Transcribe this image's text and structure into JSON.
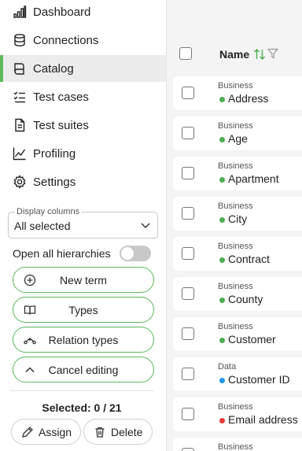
{
  "nav": {
    "items": [
      {
        "label": "Dashboard",
        "icon": "bar-chart-icon",
        "active": false
      },
      {
        "label": "Connections",
        "icon": "database-icon",
        "active": false
      },
      {
        "label": "Catalog",
        "icon": "book-icon",
        "active": true
      },
      {
        "label": "Test cases",
        "icon": "checklist-icon",
        "active": false
      },
      {
        "label": "Test suites",
        "icon": "document-icon",
        "active": false
      },
      {
        "label": "Profiling",
        "icon": "line-chart-icon",
        "active": false
      },
      {
        "label": "Settings",
        "icon": "gear-icon",
        "active": false
      }
    ]
  },
  "display_columns": {
    "legend": "Display columns",
    "value": "All selected"
  },
  "hierarchies": {
    "label": "Open all hierarchies",
    "on": false
  },
  "buttons": {
    "new_term": "New term",
    "types": "Types",
    "relation_types": "Relation types",
    "cancel_editing": "Cancel editing"
  },
  "selection": {
    "text": "Selected: 0 / 21"
  },
  "actions": {
    "assign": "Assign",
    "delete": "Delete"
  },
  "table": {
    "column_name": "Name",
    "rows": [
      {
        "category": "Business",
        "name": "Address",
        "status_color": "#4caf50"
      },
      {
        "category": "Business",
        "name": "Age",
        "status_color": "#4caf50"
      },
      {
        "category": "Business",
        "name": "Apartment",
        "status_color": "#4caf50"
      },
      {
        "category": "Business",
        "name": "City",
        "status_color": "#4caf50"
      },
      {
        "category": "Business",
        "name": "Contract",
        "status_color": "#4caf50"
      },
      {
        "category": "Business",
        "name": "County",
        "status_color": "#4caf50"
      },
      {
        "category": "Business",
        "name": "Customer",
        "status_color": "#4caf50"
      },
      {
        "category": "Data",
        "name": "Customer ID",
        "status_color": "#2196f3"
      },
      {
        "category": "Business",
        "name": "Email address",
        "status_color": "#e53935"
      },
      {
        "category": "Business",
        "name": "",
        "status_color": "#4caf50"
      }
    ]
  },
  "colors": {
    "accent": "#5cb85c",
    "active_bg": "#ececec"
  }
}
